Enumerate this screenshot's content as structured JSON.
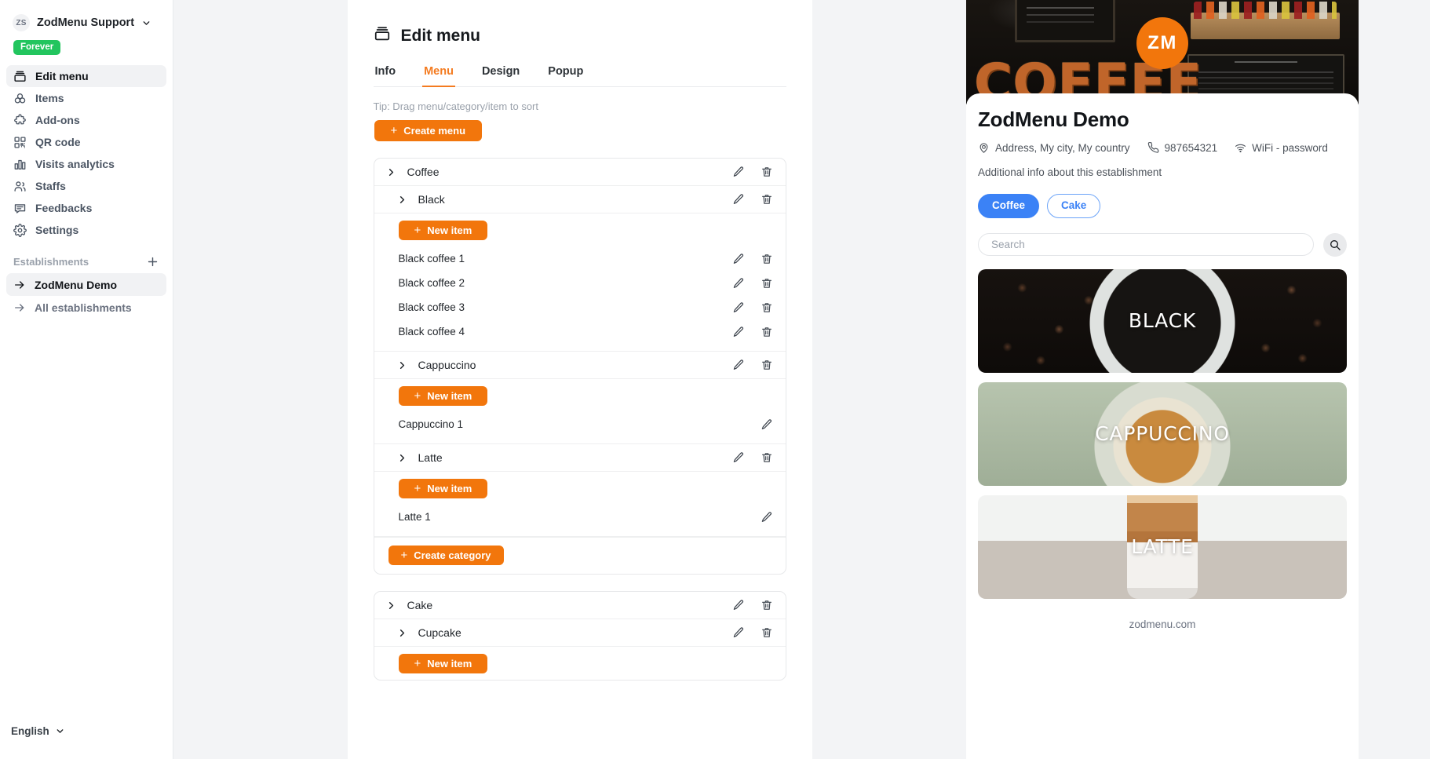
{
  "sidebar": {
    "account": {
      "initials": "ZS",
      "name": "ZodMenu Support",
      "badge": "Forever"
    },
    "nav": [
      {
        "label": "Edit menu",
        "icon": "box-icon",
        "active": true
      },
      {
        "label": "Items",
        "icon": "items-icon",
        "active": false
      },
      {
        "label": "Add-ons",
        "icon": "puzzle-icon",
        "active": false
      },
      {
        "label": "QR code",
        "icon": "qr-icon",
        "active": false
      },
      {
        "label": "Visits analytics",
        "icon": "bar-chart-icon",
        "active": false
      },
      {
        "label": "Staffs",
        "icon": "users-icon",
        "active": false
      },
      {
        "label": "Feedbacks",
        "icon": "chat-icon",
        "active": false
      },
      {
        "label": "Settings",
        "icon": "gear-icon",
        "active": false
      }
    ],
    "establishments_title": "Establishments",
    "establishments": [
      {
        "label": "ZodMenu Demo",
        "active": true
      },
      {
        "label": "All establishments",
        "active": false
      }
    ],
    "language": "English"
  },
  "main": {
    "title": "Edit menu",
    "tabs": [
      {
        "label": "Info",
        "active": false
      },
      {
        "label": "Menu",
        "active": true
      },
      {
        "label": "Design",
        "active": false
      },
      {
        "label": "Popup",
        "active": false
      }
    ],
    "tip": "Tip: Drag menu/category/item to sort",
    "create_menu_label": "Create menu",
    "new_item_label": "New item",
    "create_category_label": "Create category",
    "menus": [
      {
        "name": "Coffee",
        "categories": [
          {
            "name": "Black",
            "items": [
              "Black coffee 1",
              "Black coffee 2",
              "Black coffee 3",
              "Black coffee 4"
            ]
          },
          {
            "name": "Cappuccino",
            "items": [
              "Cappuccino 1"
            ]
          },
          {
            "name": "Latte",
            "items": [
              "Latte 1"
            ]
          }
        ]
      },
      {
        "name": "Cake",
        "categories": [
          {
            "name": "Cupcake",
            "items": []
          }
        ]
      }
    ]
  },
  "preview": {
    "logo_text": "ZM",
    "hero_text": "COFFEE",
    "establishment": "ZodMenu Demo",
    "address": "Address, My city, My country",
    "phone": "987654321",
    "wifi": "WiFi - password",
    "additional_info": "Additional info about this establishment",
    "menu_pills": [
      {
        "label": "Coffee",
        "selected": true
      },
      {
        "label": "Cake",
        "selected": false
      }
    ],
    "search_placeholder": "Search",
    "search_value": "",
    "categories": [
      {
        "label": "BLACK",
        "image": "black-coffee-photo"
      },
      {
        "label": "CAPPUCCINO",
        "image": "cappuccino-photo"
      },
      {
        "label": "LATTE",
        "image": "latte-photo"
      }
    ],
    "footer_url": "zodmenu.com"
  },
  "colors": {
    "accent_orange": "#f2760c",
    "badge_green": "#22c55e",
    "pill_blue": "#3b82f6",
    "page_bg": "#f3f4f6"
  }
}
